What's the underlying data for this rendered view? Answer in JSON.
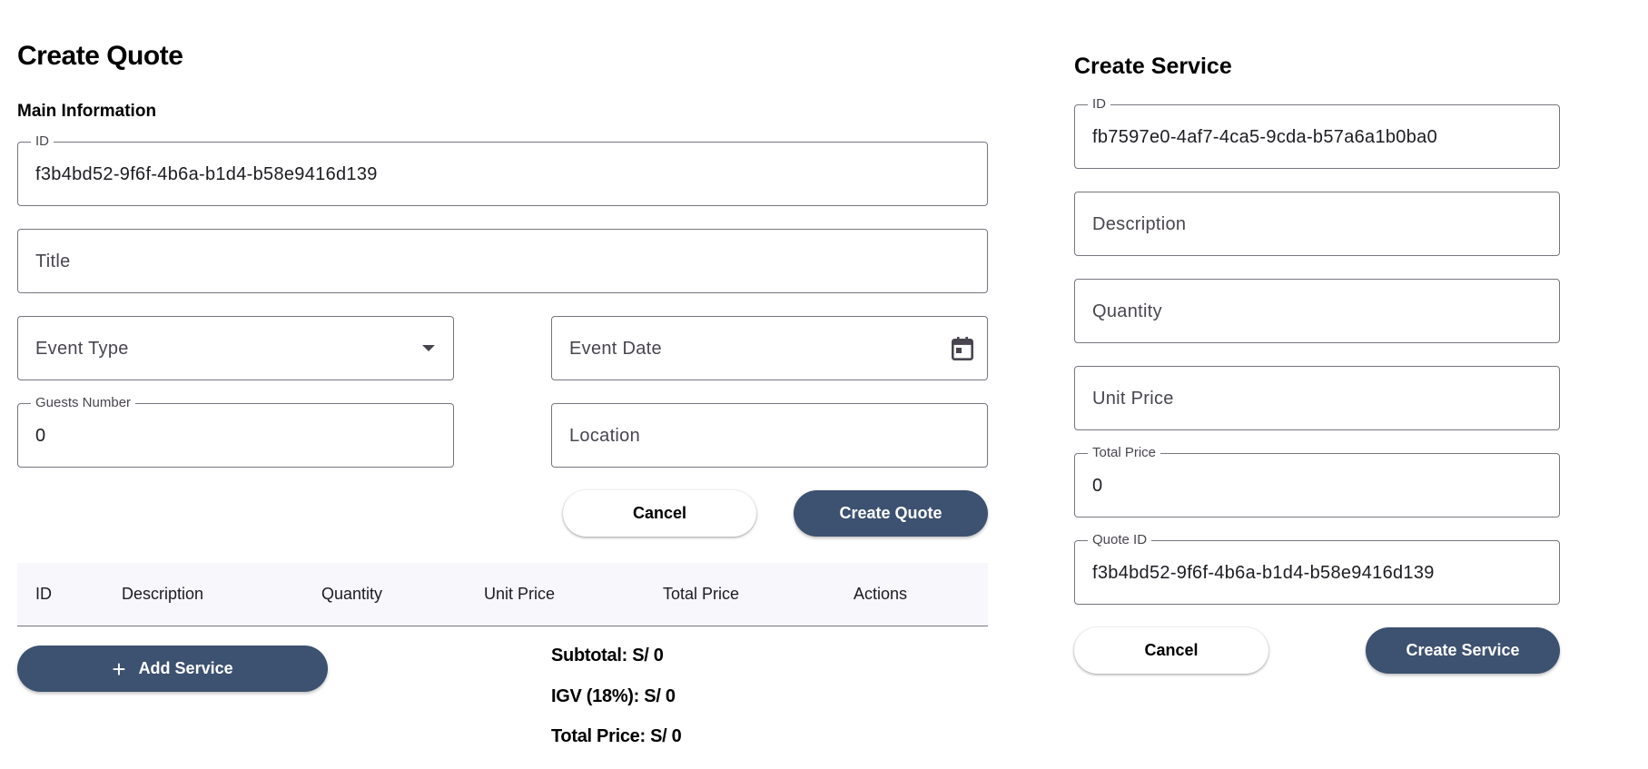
{
  "quote": {
    "title": "Create Quote",
    "section_title": "Main Information",
    "id_label": "ID",
    "id_value": "f3b4bd52-9f6f-4b6a-b1d4-b58e9416d139",
    "title_placeholder": "Title",
    "event_type_placeholder": "Event Type",
    "event_date_placeholder": "Event Date",
    "guests_label": "Guests Number",
    "guests_value": "0",
    "location_placeholder": "Location",
    "cancel_label": "Cancel",
    "create_label": "Create Quote"
  },
  "table": {
    "columns": [
      "ID",
      "Description",
      "Quantity",
      "Unit Price",
      "Total Price",
      "Actions"
    ]
  },
  "add_service_label": "Add Service",
  "summary": {
    "subtotal": "Subtotal: S/ 0",
    "igv": "IGV (18%): S/ 0",
    "total": "Total Price: S/ 0"
  },
  "service": {
    "title": "Create Service",
    "id_label": "ID",
    "id_value": "fb7597e0-4af7-4ca5-9cda-b57a6a1b0ba0",
    "description_placeholder": "Description",
    "quantity_placeholder": "Quantity",
    "unit_price_placeholder": "Unit Price",
    "total_price_label": "Total Price",
    "total_price_value": "0",
    "quote_id_label": "Quote ID",
    "quote_id_value": "f3b4bd52-9f6f-4b6a-b1d4-b58e9416d139",
    "cancel_label": "Cancel",
    "create_label": "Create Service"
  },
  "colors": {
    "primary_button": "#3d5170",
    "outline": "#79747e",
    "table_header_bg": "#f7f7fc"
  },
  "icons": {
    "event_type_trailing": "dropdown-arrow-icon",
    "event_date_trailing": "calendar-icon",
    "add_service_leading": "plus-icon"
  }
}
